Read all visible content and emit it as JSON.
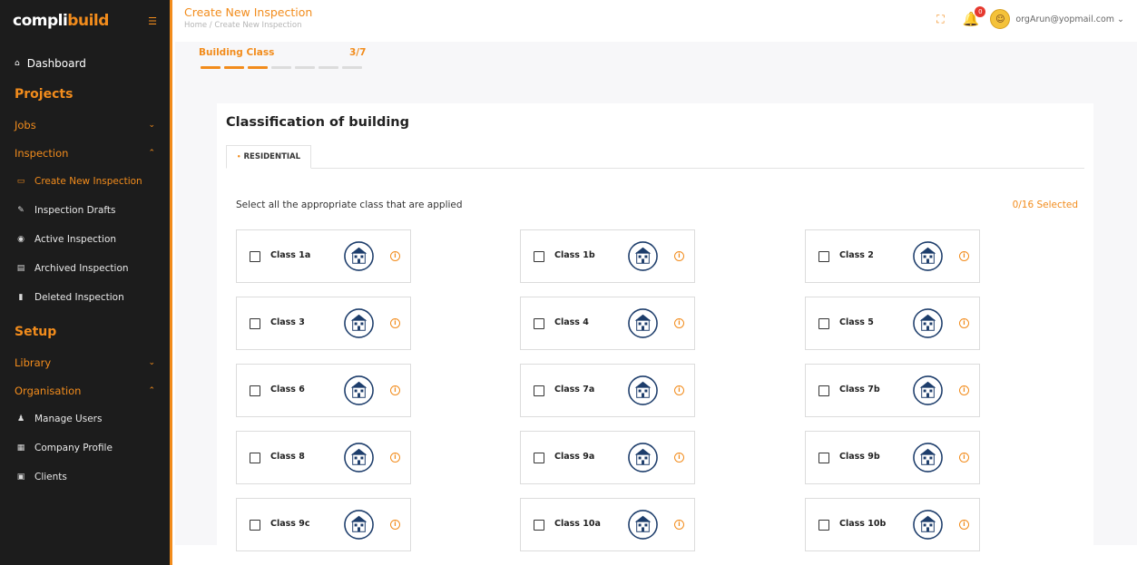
{
  "app": {
    "logo_left": "compli",
    "logo_right": "build"
  },
  "sidebar": {
    "dashboard": "Dashboard",
    "projects_heading": "Projects",
    "jobs": "Jobs",
    "inspection": "Inspection",
    "inspection_items": [
      {
        "label": "Create New Inspection",
        "icon": "document-icon",
        "active": true
      },
      {
        "label": "Inspection Drafts",
        "icon": "draft-icon",
        "active": false
      },
      {
        "label": "Active Inspection",
        "icon": "active-icon",
        "active": false
      },
      {
        "label": "Archived Inspection",
        "icon": "archive-icon",
        "active": false
      },
      {
        "label": "Deleted Inspection",
        "icon": "trash-icon",
        "active": false
      }
    ],
    "setup_heading": "Setup",
    "library": "Library",
    "organisation": "Organisation",
    "org_items": [
      {
        "label": "Manage Users",
        "icon": "users-icon"
      },
      {
        "label": "Company Profile",
        "icon": "company-icon"
      },
      {
        "label": "Clients",
        "icon": "clients-icon"
      }
    ]
  },
  "topbar": {
    "title": "Create New Inspection",
    "breadcrumb": "Home / Create New Inspection",
    "notification_count": "0",
    "user_email": "orgArun@yopmail.com"
  },
  "stepper": {
    "label": "Building Class",
    "count": "3/7",
    "current": 3,
    "total": 7
  },
  "content": {
    "heading": "Classification of building",
    "tab": "RESIDENTIAL",
    "instruction": "Select all the appropriate class that are applied",
    "selected_count": "0/16 Selected"
  },
  "classes": [
    {
      "label": "Class 1a",
      "icon": "house-icon"
    },
    {
      "label": "Class 1b",
      "icon": "house-icon"
    },
    {
      "label": "Class 2",
      "icon": "tower-icon"
    },
    {
      "label": "Class 3",
      "icon": "tall-building-icon"
    },
    {
      "label": "Class 4",
      "icon": "roof-building-icon"
    },
    {
      "label": "Class 5",
      "icon": "office-building-icon"
    },
    {
      "label": "Class 6",
      "icon": "shop-icon"
    },
    {
      "label": "Class 7a",
      "icon": "car-park-icon"
    },
    {
      "label": "Class 7b",
      "icon": "warehouse-icon"
    },
    {
      "label": "Class 8",
      "icon": "factory-icon"
    },
    {
      "label": "Class 9a",
      "icon": "hospital-icon"
    },
    {
      "label": "Class 9b",
      "icon": "public-building-icon"
    },
    {
      "label": "Class 9c",
      "icon": "aged-care-icon"
    },
    {
      "label": "Class 10a",
      "icon": "garage-icon"
    },
    {
      "label": "Class 10b",
      "icon": "garage-structure-icon"
    }
  ],
  "colors": {
    "accent": "#f28c1c",
    "sidebar_bg": "#1c1c1c",
    "icon_navy": "#1d3d6b"
  }
}
